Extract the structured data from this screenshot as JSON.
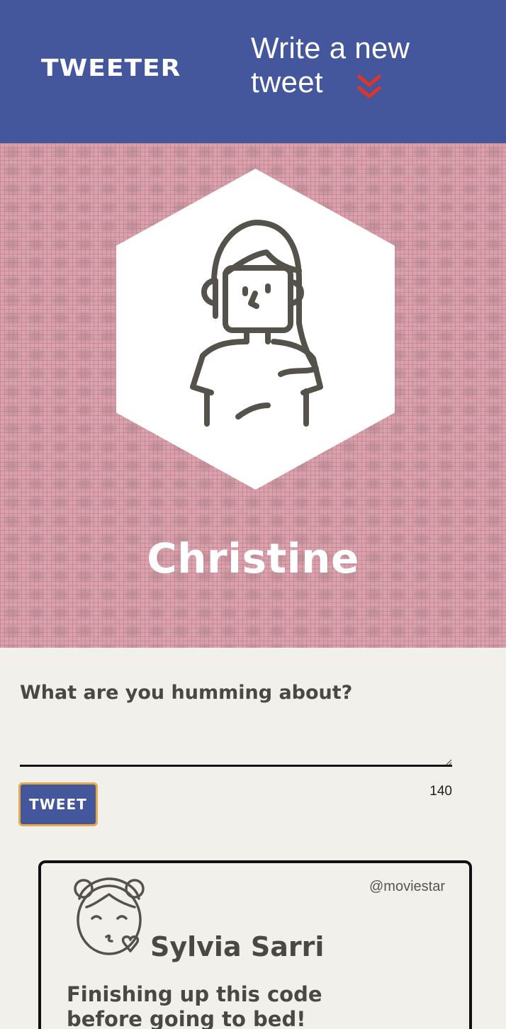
{
  "header": {
    "logo": "TWEETER",
    "write_link": "Write a new tweet",
    "chevron_icon": "double-chevron-down-icon",
    "bg_color": "#44579d",
    "chevron_color": "#e0342a"
  },
  "profile": {
    "name": "Christine",
    "avatar_icon": "woman-avatar-icon"
  },
  "compose": {
    "prompt": "What are you humming about?",
    "input_value": "",
    "button_label": "TWEET",
    "char_count": "140"
  },
  "feed": {
    "tweets": [
      {
        "handle": "@moviestar",
        "name": "Sylvia Sarri",
        "text": "Finishing up this code before going to bed!",
        "avatar_icon": "girl-kiss-avatar-icon"
      }
    ]
  }
}
